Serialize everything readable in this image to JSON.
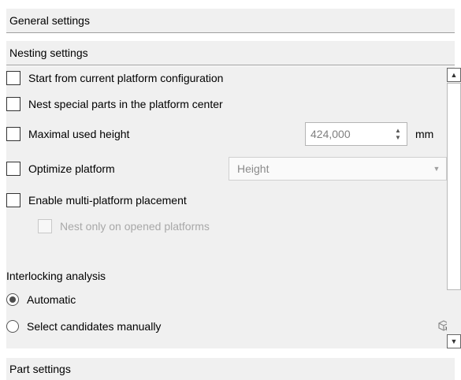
{
  "sections": {
    "general": "General settings",
    "nesting": "Nesting settings",
    "part": "Part settings"
  },
  "nesting": {
    "start_from_current": {
      "label": "Start from current platform configuration",
      "checked": false
    },
    "nest_special_center": {
      "label": "Nest special parts in the platform center",
      "checked": false
    },
    "max_used_height": {
      "label": "Maximal used height",
      "checked": false,
      "value": "424,000",
      "unit": "mm"
    },
    "optimize_platform": {
      "label": "Optimize platform",
      "checked": false,
      "selected": "Height"
    },
    "multi_platform": {
      "label": "Enable multi-platform placement",
      "checked": false
    },
    "nest_only_opened": {
      "label": "Nest only on opened platforms",
      "checked": false,
      "disabled": true
    }
  },
  "interlocking": {
    "heading": "Interlocking analysis",
    "automatic": {
      "label": "Automatic",
      "selected": true
    },
    "manual": {
      "label": "Select candidates manually",
      "selected": false
    }
  },
  "icons": {
    "pick_candidates": "cube-select-icon",
    "scroll_up": "triangle-up-icon",
    "scroll_down": "triangle-down-icon",
    "spin": "spin-arrows-icon",
    "dropdown": "chevron-down-icon"
  },
  "colors": {
    "panel_bg": "#f0f0f0",
    "disabled_text": "#a8a8a8"
  }
}
